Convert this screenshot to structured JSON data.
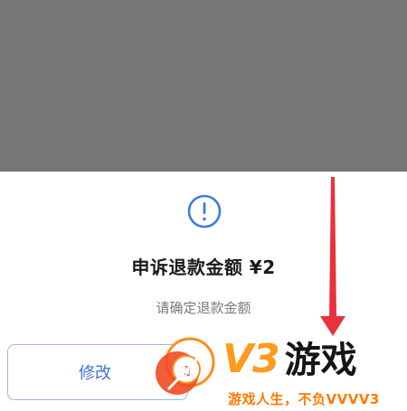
{
  "dialog": {
    "icon": "info-circle-icon",
    "title": "申诉退款金额 ¥2",
    "subtitle": "请确定退款金额",
    "modify_label": "修改"
  },
  "watermark": {
    "brand_latin": "V3",
    "brand_cn": "游戏",
    "slogan": "游戏人生，不负VVVV3"
  },
  "colors": {
    "overlay": "#767676",
    "accent_blue": "#3f74d6",
    "arrow_red": "#e8323c",
    "brand_orange": "#ff9a1f"
  }
}
